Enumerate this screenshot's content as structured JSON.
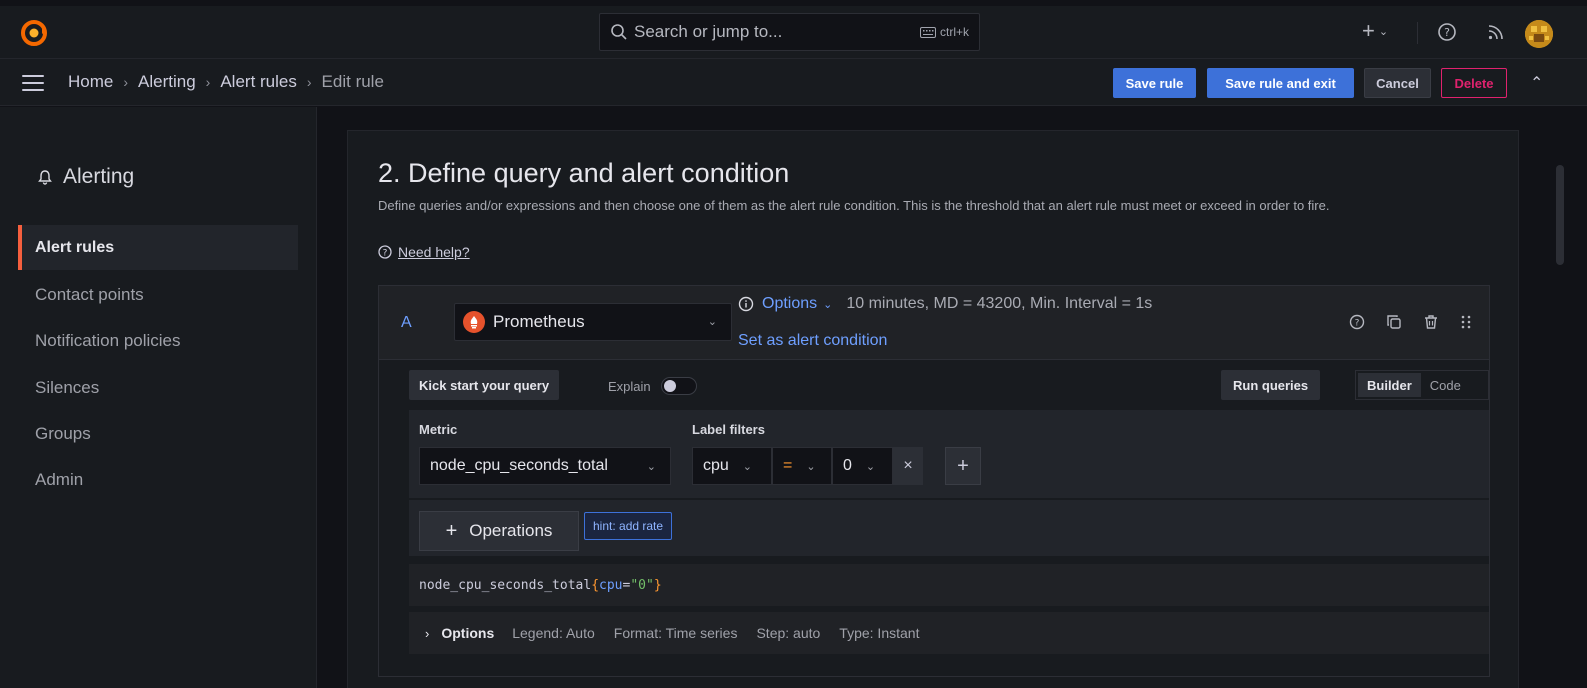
{
  "topbar": {
    "search_placeholder": "Search or jump to...",
    "search_shortcut": "ctrl+k",
    "icons": [
      "grafana-logo-icon",
      "search-icon",
      "keyboard-icon",
      "plus-icon",
      "help-icon",
      "news-icon",
      "avatar"
    ]
  },
  "breadcrumb": {
    "items": [
      "Home",
      "Alerting",
      "Alert rules",
      "Edit rule"
    ]
  },
  "actions": {
    "save_rule": "Save rule",
    "save_rule_exit": "Save rule and exit",
    "cancel": "Cancel",
    "delete": "Delete"
  },
  "sidebar": {
    "title": "Alerting",
    "items": [
      {
        "label": "Alert rules",
        "active": true
      },
      {
        "label": "Contact points",
        "active": false
      },
      {
        "label": "Notification policies",
        "active": false
      },
      {
        "label": "Silences",
        "active": false
      },
      {
        "label": "Groups",
        "active": false
      },
      {
        "label": "Admin",
        "active": false
      }
    ]
  },
  "section": {
    "title": "2. Define query and alert condition",
    "description": "Define queries and/or expressions and then choose one of them as the alert rule condition. This is the threshold that an alert rule must meet or exceed in order to fire.",
    "help_link": "Need help?"
  },
  "query": {
    "ref_id": "A",
    "datasource": "Prometheus",
    "options_label": "Options",
    "options_info": "10 minutes, MD = 43200, Min. Interval = 1s",
    "set_condition": "Set as alert condition",
    "kick_start": "Kick start your query",
    "explain": "Explain",
    "run_queries": "Run queries",
    "mode_builder": "Builder",
    "mode_code": "Code",
    "metric_label": "Metric",
    "metric_value": "node_cpu_seconds_total",
    "label_filters_label": "Label filters",
    "filter_label": "cpu",
    "filter_op": "=",
    "filter_value": "0",
    "remove_filter": "×",
    "add_filter": "+",
    "operations_plus": "+",
    "operations": "Operations",
    "hint": "hint: add rate",
    "raw_metric": "node_cpu_seconds_total",
    "raw_open": "{",
    "raw_label": "cpu",
    "raw_eq": "=",
    "raw_value": "\"0\"",
    "raw_close": "}",
    "options_expand": "Options",
    "opt_legend": "Legend: Auto",
    "opt_format": "Format: Time series",
    "opt_step": "Step: auto",
    "opt_type": "Type: Instant"
  },
  "colors": {
    "accent_blue": "#3d71d9",
    "link_blue": "#6e9fff",
    "danger": "#e0226e",
    "active_marker": "#f55f3e"
  }
}
